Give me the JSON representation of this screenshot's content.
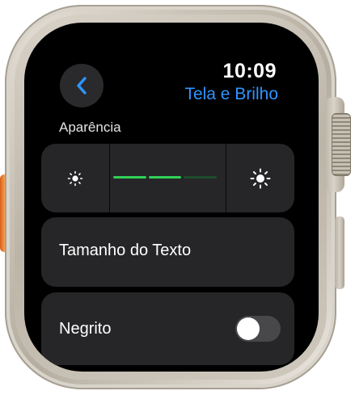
{
  "status": {
    "time": "10:09"
  },
  "header": {
    "back_icon": "chevron-left-icon",
    "title": "Tela e Brilho"
  },
  "brightness": {
    "section_label": "Aparência",
    "decrease_icon": "sun-small-icon",
    "increase_icon": "sun-large-icon",
    "level_segments_total": 3,
    "level_segments_on": 2
  },
  "text_size": {
    "label": "Tamanho do Texto"
  },
  "bold_text": {
    "label": "Negrito",
    "enabled": false
  },
  "colors": {
    "accent": "#2f95ff",
    "level_on": "#30d158",
    "level_off": "#1e4d2c",
    "card": "#262628",
    "screen": "#000000",
    "action_button": "#f08a3a"
  }
}
